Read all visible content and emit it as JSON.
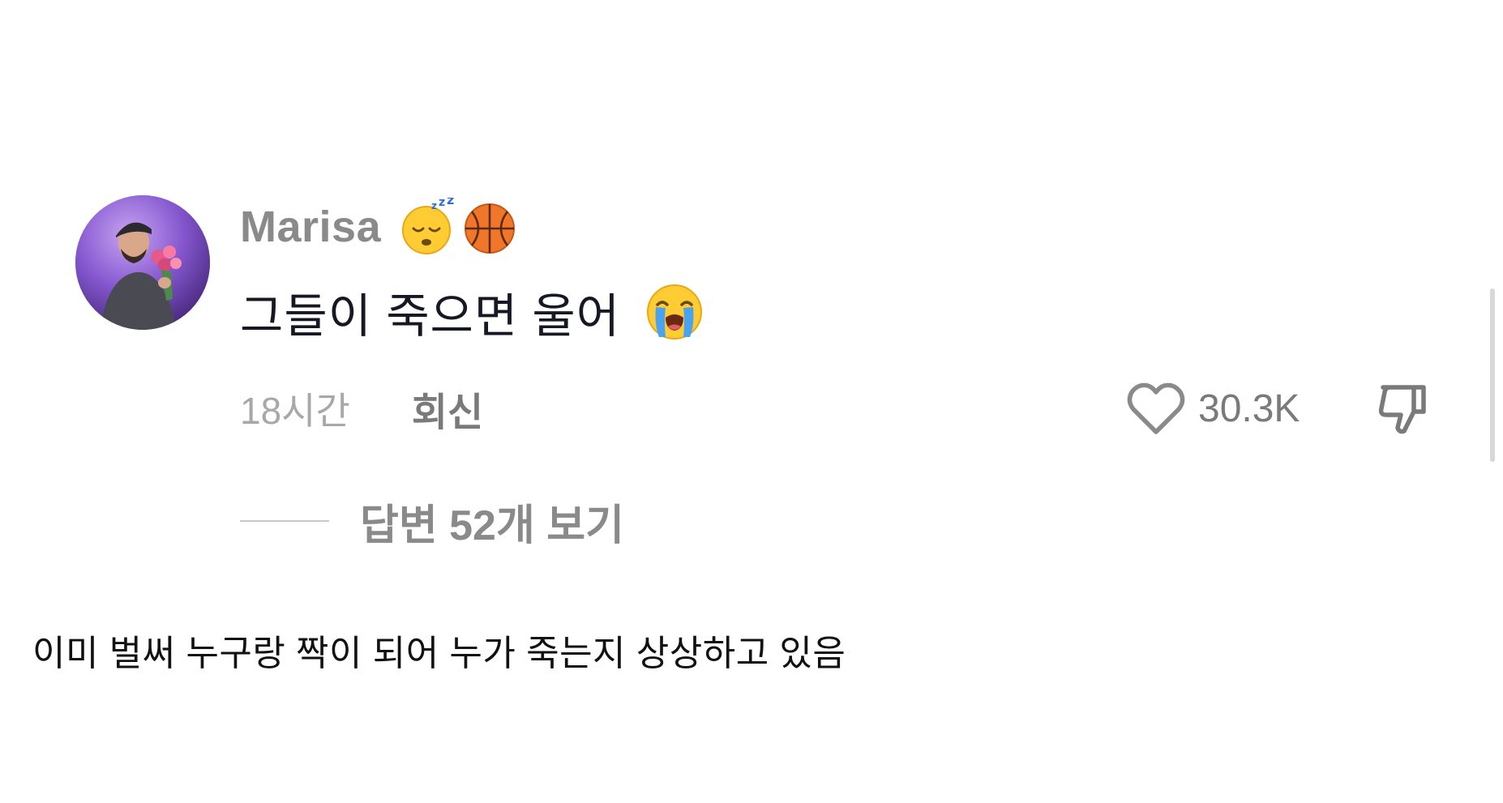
{
  "comment": {
    "username": "Marisa",
    "username_badges": [
      "sleeping-face-emoji",
      "basketball-emoji"
    ],
    "text": "그들이 죽으면 울어",
    "text_emoji": "loudly-crying-face-emoji",
    "time_ago": "18시간",
    "reply_label": "회신",
    "like_count": "30.3K",
    "like_icon": "heart-outline-icon",
    "dislike_icon": "thumbs-down-icon",
    "view_replies_label": "답변 52개 보기"
  },
  "caption": "이미 벌써 누구랑 짝이 되어 누가 죽는지 상상하고 있음",
  "colors": {
    "background": "#ffffff",
    "username": "#8a8a8a",
    "comment_text": "#161823",
    "meta_text": "#a8a8a8",
    "accent_purple": "#7d4fc8"
  }
}
